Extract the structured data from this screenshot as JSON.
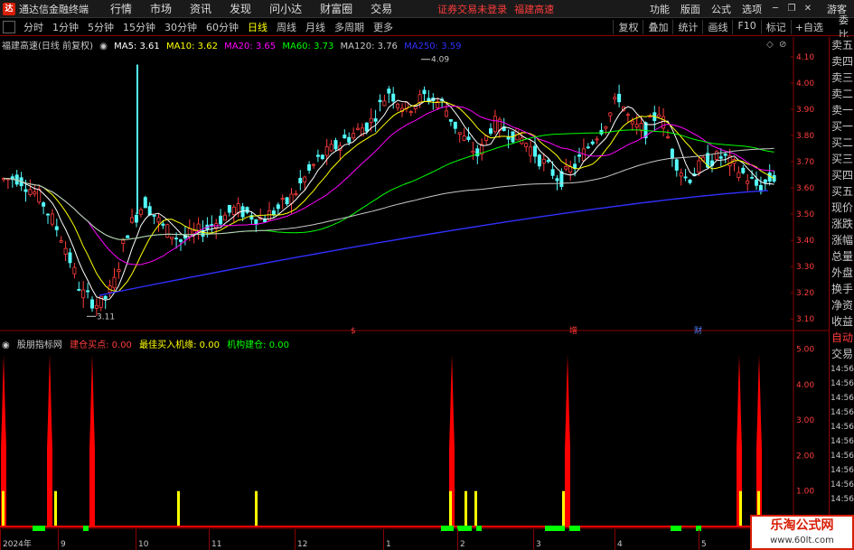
{
  "app": {
    "title": "通达信金融终端",
    "menu": [
      "行情",
      "市场",
      "资讯",
      "发现",
      "问小达",
      "财富圈",
      "交易"
    ],
    "login_status": "证券交易未登录",
    "stock_name": "福建高速",
    "right_menu": [
      "功能",
      "版面",
      "公式",
      "选项"
    ],
    "guest": "游客"
  },
  "tabs": {
    "periods": [
      "分时",
      "1分钟",
      "5分钟",
      "15分钟",
      "30分钟",
      "60分钟",
      "日线",
      "周线",
      "月线",
      "多周期",
      "更多"
    ],
    "active": "日线",
    "tools": [
      "复权",
      "叠加",
      "统计",
      "画线",
      "F10",
      "标记"
    ],
    "auto_select": "+自选",
    "sidebar_header": "委比"
  },
  "main_legend": {
    "stock": "福建高速(日线 前复权)",
    "ma5": "MA5: 3.61",
    "ma10": "MA10: 3.62",
    "ma20": "MA20: 3.65",
    "ma60": "MA60: 3.73",
    "ma120": "MA120: 3.76",
    "ma250": "MA250: 3.59"
  },
  "indicator_legend": {
    "name": "股朋指标网",
    "buy_point": "建仓买点: 0.00",
    "best_buy": "最佳买入机缘: 0.00",
    "inst_build": "机构建仓: 0.00"
  },
  "annotations": {
    "high": "4.09",
    "low": "3.11",
    "marks": [
      {
        "label": "$",
        "color": "#ff3c3c"
      },
      {
        "label": "增",
        "color": "#ff3c3c"
      },
      {
        "label": "财",
        "color": "#5080ff"
      }
    ]
  },
  "axes": {
    "price_ticks": [
      "4.10",
      "4.00",
      "3.90",
      "3.80",
      "3.70",
      "3.60",
      "3.50",
      "3.40",
      "3.30",
      "3.20",
      "3.10"
    ],
    "indicator_ticks": [
      "5.00",
      "4.00",
      "3.00",
      "2.00",
      "1.00"
    ],
    "dates": [
      "2024年",
      "9",
      "10",
      "11",
      "12",
      "1",
      "2",
      "3",
      "4",
      "5"
    ]
  },
  "sidebar": {
    "items": [
      "卖五",
      "卖四",
      "卖三",
      "卖二",
      "卖一",
      "买一",
      "买二",
      "买三",
      "买四",
      "买五",
      "现价",
      "涨跌",
      "涨幅",
      "总量",
      "外盘",
      "换手",
      "净资",
      "收益"
    ],
    "auto": "自动",
    "trade": "交易",
    "times": [
      "14:56",
      "14:56",
      "14:56",
      "14:56",
      "14:56",
      "14:56",
      "14:56",
      "14:56",
      "14:56",
      "14:56"
    ]
  },
  "watermark": {
    "title": "乐淘公式网",
    "url": "www.60lt.com"
  },
  "colors": {
    "up": "#ff3c3c",
    "down": "#54fcfc",
    "ma5": "#ffffff",
    "ma10": "#ffff00",
    "ma20": "#ff00ff",
    "ma60": "#00ff00",
    "ma120": "#c8c8c8",
    "ma250": "#3030ff",
    "buy_point": "#ff0000",
    "best_buy": "#ffff00",
    "inst_build": "#00ff00"
  }
}
